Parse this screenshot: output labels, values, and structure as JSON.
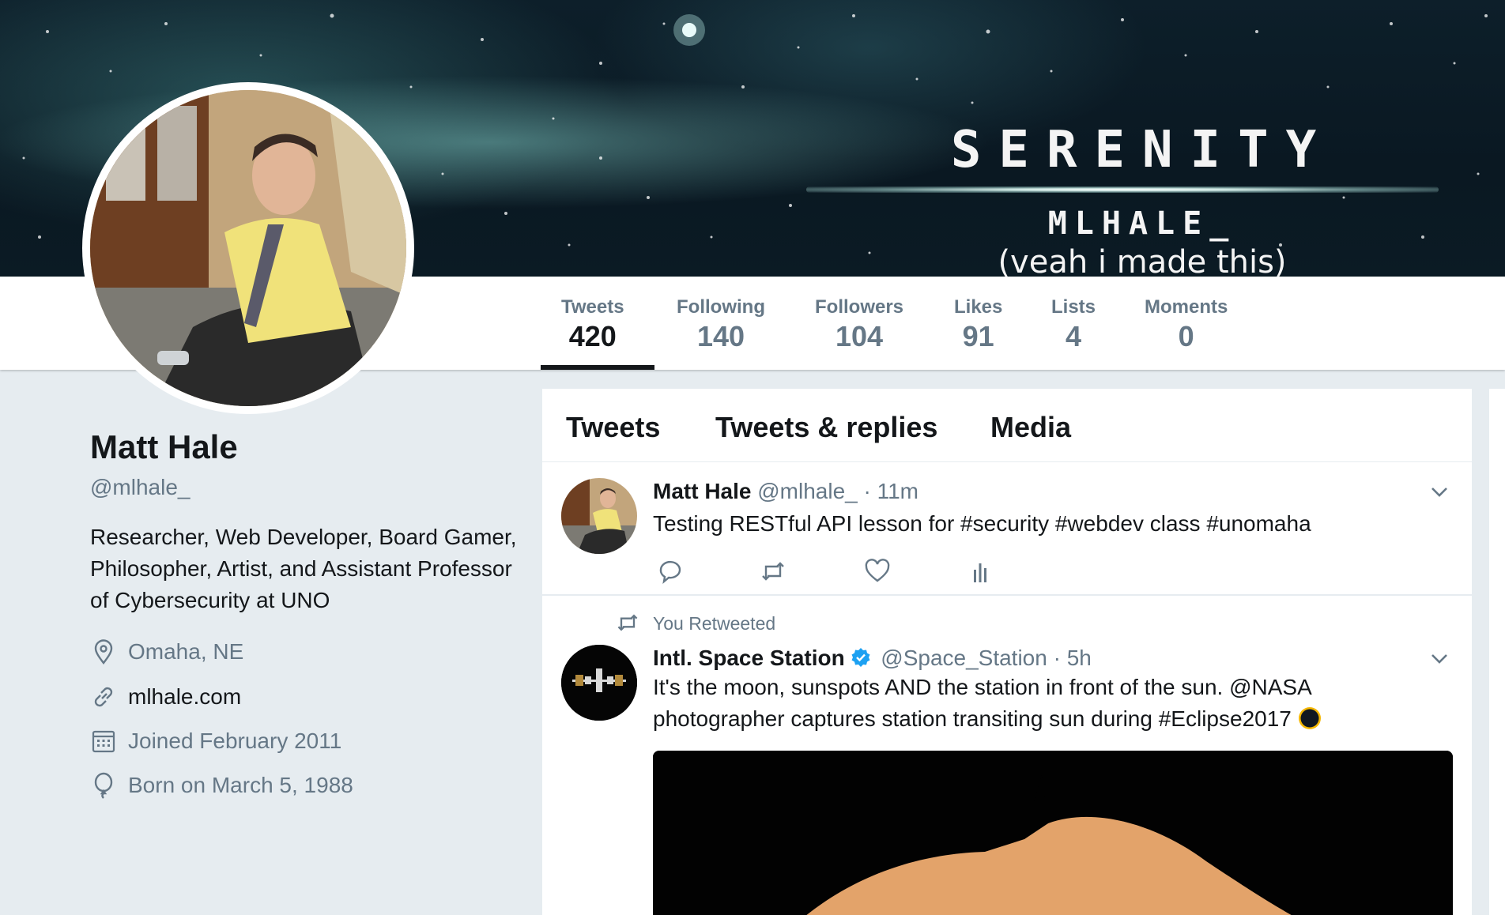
{
  "banner": {
    "title": "SERENITY",
    "subtitle": "MLHALE_",
    "note": "(veah i made this)"
  },
  "stats": [
    {
      "label": "Tweets",
      "value": "420",
      "active": true
    },
    {
      "label": "Following",
      "value": "140",
      "active": false
    },
    {
      "label": "Followers",
      "value": "104",
      "active": false
    },
    {
      "label": "Likes",
      "value": "91",
      "active": false
    },
    {
      "label": "Lists",
      "value": "4",
      "active": false
    },
    {
      "label": "Moments",
      "value": "0",
      "active": false
    }
  ],
  "profile": {
    "name": "Matt Hale",
    "handle": "@mlhale_",
    "bio": "Researcher, Web Developer, Board Gamer, Philosopher, Artist, and Assistant Professor of Cybersecurity at UNO",
    "location": "Omaha, NE",
    "website": "mlhale.com",
    "joined": "Joined February 2011",
    "born": "Born on March 5, 1988"
  },
  "timeline": {
    "tabs": [
      "Tweets",
      "Tweets & replies",
      "Media"
    ],
    "tweets": [
      {
        "name": "Matt Hale",
        "handle": "@mlhale_",
        "time": "· 11m",
        "text": "Testing RESTful API lesson for #security #webdev class #unomaha"
      },
      {
        "retweet_label": "You Retweeted",
        "name": "Intl. Space Station",
        "verified": true,
        "handle": "@Space_Station",
        "time": "· 5h",
        "text": "It's the moon, sunspots AND the station in front of the sun. @NASA photographer captures station transiting sun during #Eclipse2017"
      }
    ]
  },
  "colors": {
    "accent": "#1da1f2",
    "muted": "#657786",
    "text": "#14171a",
    "page_bg": "#e6ecf0"
  },
  "icons": [
    "location-icon",
    "link-icon",
    "calendar-icon",
    "birthday-balloon-icon",
    "reply-icon",
    "retweet-icon",
    "like-icon",
    "analytics-icon",
    "chevron-down-icon",
    "verified-badge-icon",
    "eclipse-emoji-icon"
  ]
}
